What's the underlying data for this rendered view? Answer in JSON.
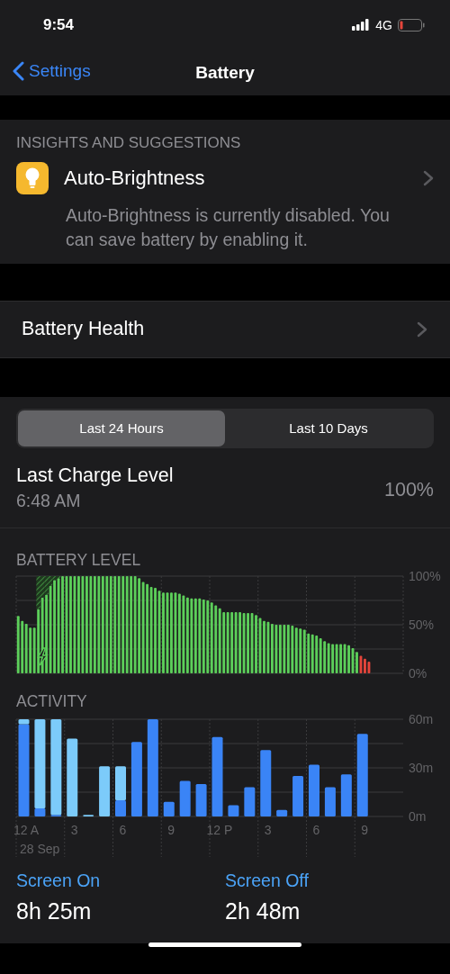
{
  "status_bar": {
    "time": "9:54",
    "network": "4G"
  },
  "nav": {
    "back": "Settings",
    "title": "Battery"
  },
  "insights": {
    "header": "INSIGHTS AND SUGGESTIONS",
    "item": {
      "title": "Auto-Brightness",
      "description": "Auto-Brightness is currently disabled. You can save battery by enabling it."
    }
  },
  "battery_health": {
    "label": "Battery Health"
  },
  "range_tabs": [
    {
      "label": "Last 24 Hours",
      "selected": true
    },
    {
      "label": "Last 10 Days",
      "selected": false
    }
  ],
  "last_charge": {
    "title": "Last Charge Level",
    "time": "6:48 AM",
    "level": "100%"
  },
  "battery_level": {
    "title": "BATTERY LEVEL",
    "chart_data": {
      "type": "bar",
      "ylim": [
        0,
        100
      ],
      "categories": [
        null,
        null,
        null,
        null,
        null,
        null,
        null,
        null,
        null,
        null,
        null,
        null,
        null,
        null,
        null,
        null,
        null,
        null,
        null,
        null,
        null,
        null,
        null,
        null,
        null,
        null,
        null,
        null,
        null,
        null,
        null,
        null,
        null,
        null,
        null,
        null,
        null,
        null,
        null,
        null,
        null,
        null,
        null,
        null,
        null,
        null,
        null,
        null,
        null,
        null,
        null,
        null,
        null,
        null,
        null,
        null,
        null,
        null,
        null,
        null,
        null,
        null,
        null,
        null,
        null,
        null,
        null,
        null,
        null,
        null,
        null,
        null,
        null,
        null,
        null,
        null,
        null,
        null,
        null,
        null,
        null,
        null,
        null,
        null,
        null,
        null,
        null,
        null,
        null,
        null,
        null,
        null,
        null,
        null,
        null,
        null
      ],
      "yticks": [
        {
          "value": 0,
          "label": "0%"
        },
        {
          "value": 50,
          "label": "50%"
        },
        {
          "value": 100,
          "label": "100%"
        }
      ],
      "series": [
        {
          "color": "#5ccf5a",
          "values": [
            59,
            54,
            51,
            47,
            47,
            66,
            78,
            81,
            90,
            96,
            98,
            100,
            100,
            100,
            100,
            100,
            100,
            100,
            100,
            100,
            100,
            100,
            100,
            100,
            100,
            100,
            100,
            100,
            100,
            100,
            98,
            94,
            92,
            89,
            88,
            85,
            83,
            83,
            83,
            83,
            82,
            80,
            78,
            77,
            77,
            77,
            76,
            75,
            73,
            70,
            67,
            63,
            63,
            63,
            63,
            63,
            62,
            62,
            62,
            60,
            57,
            54,
            53,
            51,
            50,
            50,
            50,
            50,
            49,
            47,
            46,
            45,
            41,
            40,
            39,
            36,
            33,
            31,
            30,
            30,
            30,
            30,
            29,
            26,
            22,
            null,
            null,
            null,
            null,
            null,
            null,
            null,
            null,
            null,
            null,
            null
          ]
        },
        {
          "color": "#e5453b",
          "values": [
            null,
            null,
            null,
            null,
            null,
            null,
            null,
            null,
            null,
            null,
            null,
            null,
            null,
            null,
            null,
            null,
            null,
            null,
            null,
            null,
            null,
            null,
            null,
            null,
            null,
            null,
            null,
            null,
            null,
            null,
            null,
            null,
            null,
            null,
            null,
            null,
            null,
            null,
            null,
            null,
            null,
            null,
            null,
            null,
            null,
            null,
            null,
            null,
            null,
            null,
            null,
            null,
            null,
            null,
            null,
            null,
            null,
            null,
            null,
            null,
            null,
            null,
            null,
            null,
            null,
            null,
            null,
            null,
            null,
            null,
            null,
            null,
            null,
            null,
            null,
            null,
            null,
            null,
            null,
            null,
            null,
            null,
            null,
            null,
            null,
            18,
            15,
            12,
            null,
            null,
            null,
            null,
            null,
            null,
            null,
            null
          ]
        }
      ]
    }
  },
  "activity": {
    "title": "ACTIVITY",
    "date": "28 Sep",
    "chart_data": {
      "type": "bar",
      "stacked": true,
      "ylim": [
        0,
        60
      ],
      "categories": [
        "12 A",
        null,
        null,
        "3",
        null,
        null,
        "6",
        null,
        null,
        "9",
        null,
        null,
        "12 P",
        null,
        null,
        "3",
        null,
        null,
        "6",
        null,
        null,
        "9",
        null,
        null
      ],
      "yticks": [
        {
          "value": 0,
          "label": "0m"
        },
        {
          "value": 30,
          "label": "30m"
        },
        {
          "value": 60,
          "label": "60m"
        }
      ],
      "series": [
        {
          "name": "Screen On",
          "color": "#3a84f6",
          "values": [
            57,
            5,
            1,
            0,
            0,
            0,
            10,
            46,
            60,
            9,
            22,
            20,
            49,
            7,
            18,
            41,
            4,
            25,
            32,
            18,
            26,
            51,
            null,
            null
          ]
        },
        {
          "name": "Screen Off",
          "color": "#7ccbfa",
          "values": [
            3,
            55,
            59,
            48,
            1,
            31,
            21,
            0,
            0,
            0,
            0,
            0,
            0,
            0,
            0,
            0,
            0,
            0,
            0,
            0,
            0,
            0,
            null,
            null
          ]
        }
      ]
    }
  },
  "summary": [
    {
      "value": "8h 25m"
    },
    {
      "value": "2h 48m"
    }
  ]
}
